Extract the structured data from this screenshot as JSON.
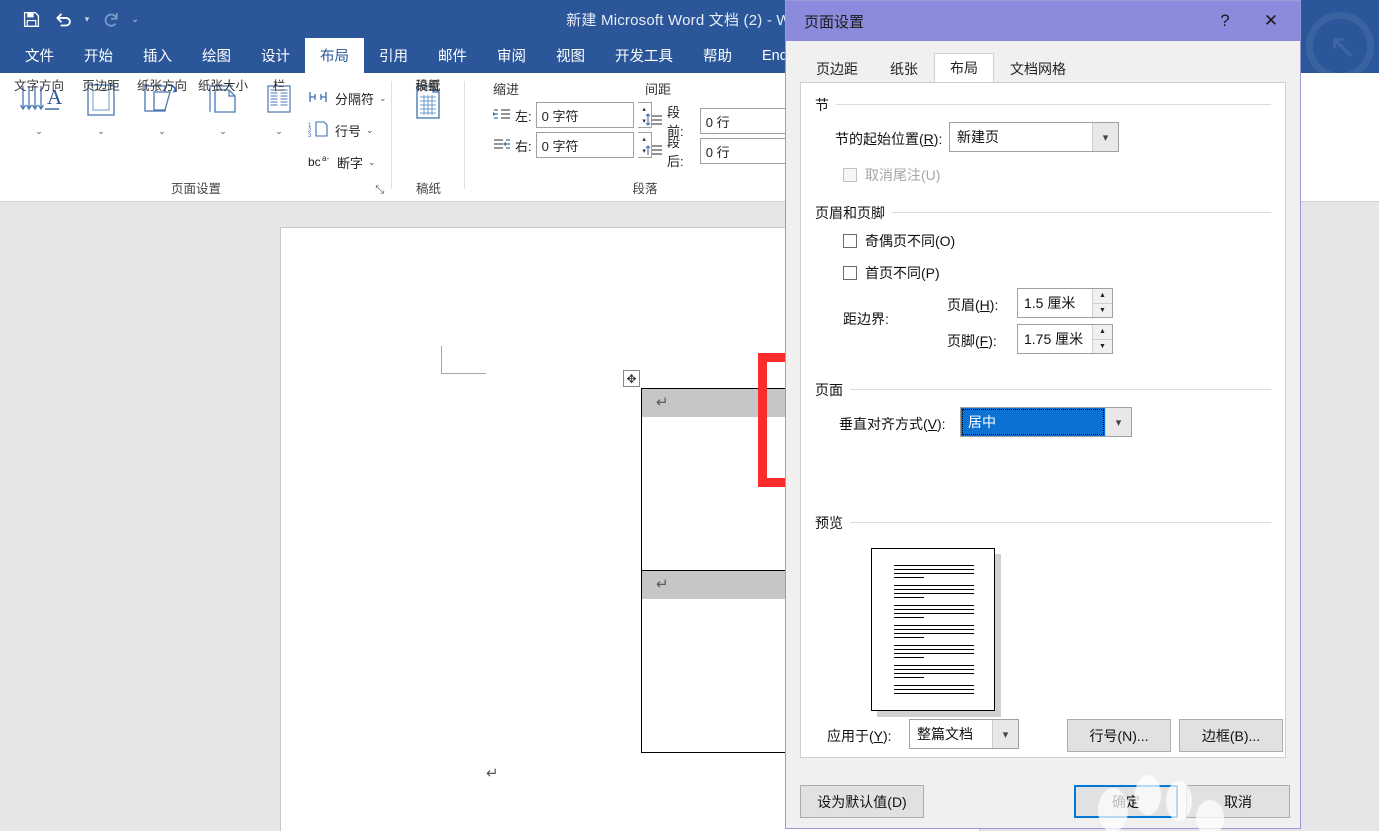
{
  "app": {
    "title": "新建 Microsoft Word 文档 (2)  -  Word",
    "quick_access": [
      {
        "name": "save-icon",
        "glyph": "💾",
        "enabled": true
      },
      {
        "name": "undo-icon",
        "glyph": "↶",
        "enabled": true
      },
      {
        "name": "redo-icon",
        "glyph": "↻",
        "enabled": false
      },
      {
        "name": "customize-qat-icon",
        "glyph": "⌄",
        "enabled": true
      }
    ],
    "tabs": [
      {
        "label": "文件",
        "active": false
      },
      {
        "label": "开始",
        "active": false
      },
      {
        "label": "插入",
        "active": false
      },
      {
        "label": "绘图",
        "active": false
      },
      {
        "label": "设计",
        "active": false
      },
      {
        "label": "布局",
        "active": true
      },
      {
        "label": "引用",
        "active": false
      },
      {
        "label": "邮件",
        "active": false
      },
      {
        "label": "审阅",
        "active": false
      },
      {
        "label": "视图",
        "active": false
      },
      {
        "label": "开发工具",
        "active": false
      },
      {
        "label": "帮助",
        "active": false
      },
      {
        "label": "EndN",
        "active": false
      }
    ]
  },
  "ribbon": {
    "page_setup": {
      "group_label": "页面设置",
      "dialog_launcher": "⤡",
      "big_buttons": [
        {
          "label": "文字方向",
          "icon": "text-direction-icon",
          "caret": "⌄"
        },
        {
          "label": "页边距",
          "icon": "margins-icon",
          "caret": "⌄"
        },
        {
          "label": "纸张方向",
          "icon": "orientation-icon",
          "caret": "⌄"
        },
        {
          "label": "纸张大小",
          "icon": "paper-size-icon",
          "caret": "⌄"
        },
        {
          "label": "栏",
          "icon": "columns-icon",
          "caret": "⌄"
        }
      ],
      "small_buttons": [
        {
          "label": "分隔符",
          "icon": "breaks-icon",
          "caret": "⌄"
        },
        {
          "label": "行号",
          "icon": "line-numbers-icon",
          "caret": "⌄"
        },
        {
          "label": "断字",
          "icon": "hyphenation-icon",
          "caret": "⌄"
        }
      ]
    },
    "manuscript": {
      "group_label": "稿纸",
      "button_label_line1": "稿纸",
      "button_label_line2": "设置",
      "icon": "manuscript-settings-icon"
    },
    "paragraph": {
      "group_label": "段落",
      "indent_header": "缩进",
      "spacing_header": "间距",
      "fields": [
        {
          "label": "左:",
          "value": "0 字符",
          "icon": "indent-left-icon"
        },
        {
          "label": "右:",
          "value": "0 字符",
          "icon": "indent-right-icon"
        },
        {
          "label": "段前:",
          "value": "0 行",
          "icon": "space-before-icon"
        },
        {
          "label": "段后:",
          "value": "0 行",
          "icon": "space-after-icon"
        }
      ]
    }
  },
  "document": {
    "table_move_handle_icon": "table-move-handle-icon",
    "paragraph_mark": "↵",
    "cell_end_mark": "¤",
    "selected_cells": 2
  },
  "dialog": {
    "title": "页面设置",
    "help_icon": "?",
    "close_icon": "✕",
    "tabs": [
      {
        "label": "页边距",
        "active": false
      },
      {
        "label": "纸张",
        "active": false
      },
      {
        "label": "布局",
        "active": true
      },
      {
        "label": "文档网格",
        "active": false
      }
    ],
    "section": {
      "group_title": "节",
      "start_label": "节的起始位置(R):",
      "start_underline": "R",
      "start_value": "新建页",
      "suppress_endnotes_label": "取消尾注(U)",
      "suppress_endnotes_checked": false,
      "suppress_endnotes_disabled": true
    },
    "headers_footers": {
      "group_title": "页眉和页脚",
      "different_odd_even_label": "奇偶页不同(O)",
      "different_odd_even_checked": false,
      "different_first_page_label": "首页不同(P)",
      "different_first_page_checked": false,
      "from_edge_label": "距边界:",
      "header_label": "页眉(H):",
      "header_value": "1.5 厘米",
      "footer_label": "页脚(F):",
      "footer_value": "1.75 厘米"
    },
    "page": {
      "group_title": "页面",
      "vertical_alignment_label": "垂直对齐方式(V):",
      "vertical_alignment_value": "居中",
      "highlight_color": "#fb2c2c"
    },
    "preview": {
      "group_title": "预览",
      "apply_to_label": "应用于(Y):",
      "apply_to_value": "整篇文档",
      "line_numbers_button": "行号(N)...",
      "borders_button": "边框(B)..."
    },
    "footer_buttons": {
      "set_default": "设为默认值(D)",
      "ok": "确定",
      "cancel": "取消"
    }
  },
  "colors": {
    "word_blue": "#2b579a",
    "dialog_title": "#8b8bdd",
    "selection_blue": "#0b72d4",
    "focus_blue": "#0078d7",
    "highlight_red": "#fb2c2c"
  }
}
